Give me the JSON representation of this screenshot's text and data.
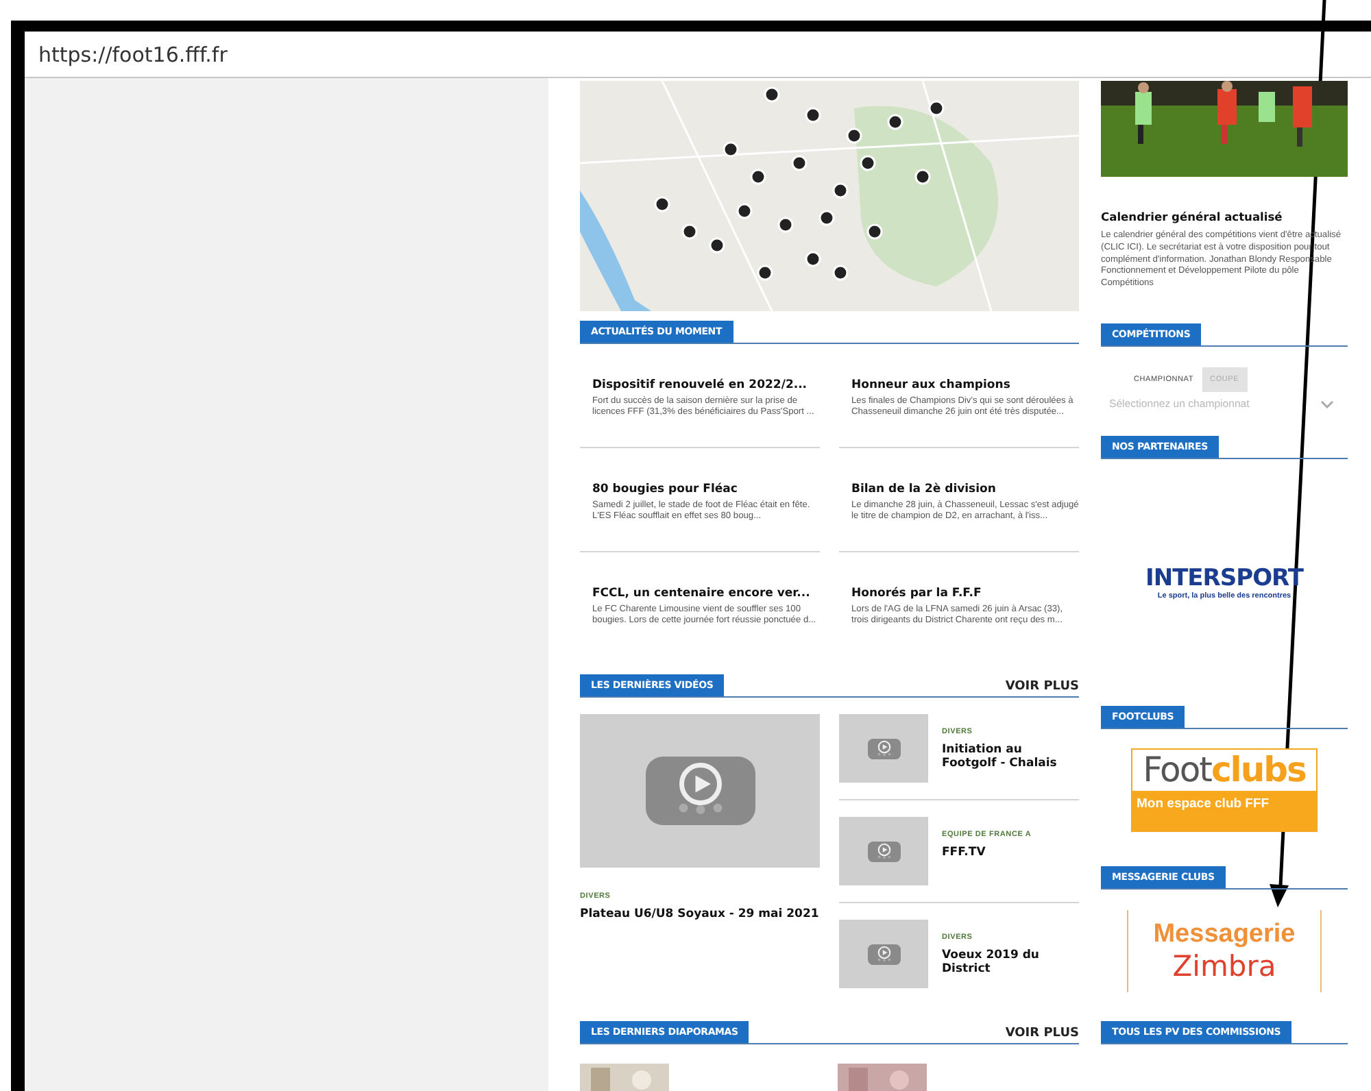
{
  "browser": {
    "url": "https://foot16.fff.fr"
  },
  "feature": {
    "kind": "picture",
    "title": "Calendrier général actualisé",
    "text": "Le calendrier général des compétitions vient d'être actualisé (CLIC ICI). Le secrétariat est à votre disposition pour tout complément d'information. Jonathan Blondy Responsable Fonctionnement et Développement Pilote du pôle Compétitions"
  },
  "news": {
    "heading": "ACTUALITÉS DU MOMENT",
    "items": [
      {
        "title": "Dispositif renouvelé en 2022/2...",
        "text": "Fort du succès de la saison dernière sur la prise de licences FFF (31,3% des bénéficiaires du Pass'Sport ..."
      },
      {
        "title": "Honneur aux champions",
        "text": "Les finales de Champions Div's qui se sont déroulées à Chasseneuil dimanche 26 juin ont été très disputée..."
      },
      {
        "title": "80 bougies pour Fléac",
        "text": "Samedi 2 juillet, le stade de foot de Fléac était en fête. L'ES Fléac soufflait en effet ses 80 boug..."
      },
      {
        "title": "Bilan de la 2è division",
        "text": "Le dimanche 28 juin, à Chasseneuil, Lessac s'est adjugé le titre de champion de D2, en arrachant, à l'iss..."
      },
      {
        "title": "FCCL, un centenaire encore ver...",
        "text": "Le FC Charente Limousine vient de souffler ses 100 bougies. Lors de cette journée fort réussie ponctuée d..."
      },
      {
        "title": "Honorés par la F.F.F",
        "text": "Lors de l'AG de la LFNA samedi 26 juin à Arsac (33), trois dirigeants du District Charente ont reçu des m..."
      }
    ]
  },
  "videos": {
    "heading": "LES DERNIÈRES VIDÉOS",
    "more": "VOIR PLUS",
    "main": {
      "category": "DIVERS",
      "title": "Plateau U6/U8 Soyaux - 29 mai 2021"
    },
    "items": [
      {
        "category": "DIVERS",
        "title": "Initiation au Footgolf - Chalais"
      },
      {
        "category": "EQUIPE DE FRANCE A",
        "title": "FFF.TV"
      },
      {
        "category": "DIVERS",
        "title": "Voeux 2019 du District"
      }
    ]
  },
  "slideshows": {
    "heading": "LES DERNIERS DIAPORAMAS",
    "more": "VOIR PLUS"
  },
  "competitions": {
    "heading": "COMPÉTITIONS",
    "tabs": [
      {
        "label": "CHAMPIONNAT",
        "selected": true
      },
      {
        "label": "COUPE",
        "selected": false
      }
    ],
    "select": {
      "placeholder": "Sélectionnez un championnat"
    }
  },
  "partners": {
    "heading": "NOS PARTENAIRES",
    "logo": {
      "name": "INTERSPORT",
      "tagline": "Le sport, la plus belle des rencontres"
    }
  },
  "footclubs": {
    "heading": "FOOTCLUBS",
    "logo": {
      "word_1": "Foot",
      "word_2": "clubs",
      "tagline": "Mon espace club FFF"
    }
  },
  "mail": {
    "heading": "MESSAGERIE CLUBS",
    "logo": {
      "line_1": "Messagerie",
      "line_2": "Zimbra"
    }
  },
  "minutes": {
    "heading": "TOUS LES PV DES COMMISSIONS"
  }
}
